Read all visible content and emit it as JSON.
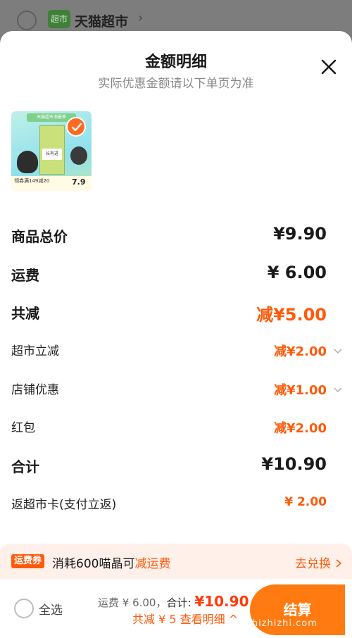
{
  "background": {
    "shop_logo_text": "超市",
    "shop_name": "天猫超市"
  },
  "modal": {
    "title": "金额明细",
    "subtitle": "实际优惠金额请以下单页为准",
    "close_icon": "close-icon"
  },
  "product": {
    "banner_text": "天猫超市消暑季",
    "label_text": "长有进",
    "bottom_text": "领券满149减20",
    "price_text": "7.9",
    "selected": true
  },
  "rows": [
    {
      "label": "商品总价",
      "value": "¥9.90",
      "style": "big",
      "color": "dark"
    },
    {
      "label": "运费",
      "value": "¥ 6.00",
      "style": "big",
      "color": "dark"
    },
    {
      "label": "共减",
      "value": "减¥5.00",
      "style": "big",
      "color": "orange"
    },
    {
      "label": "超市立减",
      "value": "减¥2.00",
      "style": "small",
      "color": "orange",
      "expandable": true
    },
    {
      "label": "店铺优惠",
      "value": "减¥1.00",
      "style": "small",
      "color": "orange",
      "expandable": true
    },
    {
      "label": "红包",
      "value": "减¥2.00",
      "style": "small",
      "color": "orange"
    },
    {
      "label": "合计",
      "value": "¥10.90",
      "style": "big",
      "color": "dark"
    },
    {
      "label": "返超市卡(支付立返)",
      "value": "¥ 2.00",
      "style": "small",
      "color": "orange"
    }
  ],
  "coupon": {
    "tag": "运费券",
    "text_prefix": "消耗600喵晶可",
    "text_highlight": "减运费",
    "action": "去兑换"
  },
  "footer": {
    "select_all": "全选",
    "shipping_label": "运费 ¥ 6.00，",
    "total_label": "合计: ",
    "total_value": "¥10.90",
    "discount_summary": "共减 ¥ 5",
    "detail_link": "查看明细",
    "checkout": "结算",
    "watermark": "zhizhizhi.com"
  },
  "colors": {
    "accent": "#ff5a0a",
    "checkout": "#ff7a10",
    "coupon_bg": "#fff0ea"
  }
}
